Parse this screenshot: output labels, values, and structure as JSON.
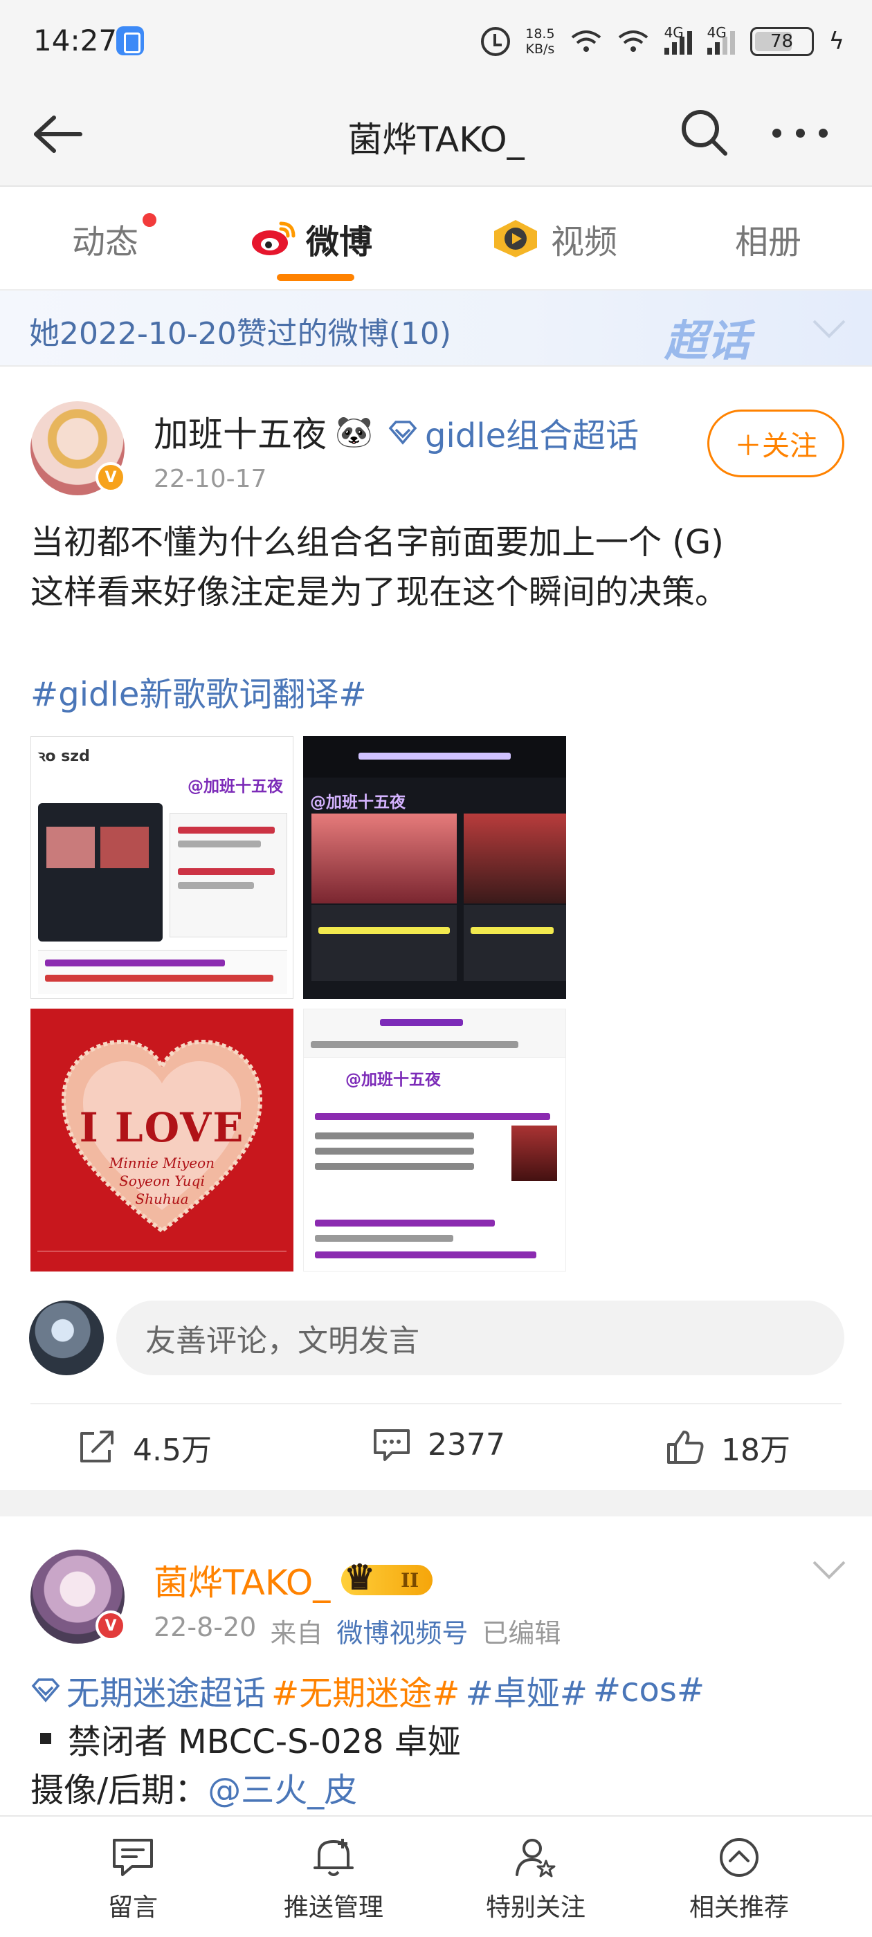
{
  "status_bar": {
    "time": "14:27",
    "speed_value": "18.5",
    "speed_unit": "KB/s",
    "network_1": "4G",
    "network_2": "4G",
    "battery": "78"
  },
  "header": {
    "title": "菌烨TAKO_"
  },
  "tabs": [
    {
      "label": "动态"
    },
    {
      "label": "微博"
    },
    {
      "label": "视频"
    },
    {
      "label": "相册"
    }
  ],
  "liked_banner": {
    "text": "她2022-10-20赞过的微博(10)",
    "mark": "超话"
  },
  "post1": {
    "author": "加班十五夜",
    "author_emoji": "🐼",
    "group_tag": "gidle组合超话",
    "date": "22-10-17",
    "follow_label": "＋关注",
    "text_line1": "当初都不懂为什么组合名字前面要加上一个 (G)",
    "text_line2": "这样看来好像注定是为了现在这个瞬间的决策。",
    "hashtag": "#gidle新歌歌词翻译#",
    "images": {
      "img1_brand": "ꝛo szd",
      "img1_watermark": "@加班十五夜",
      "img2_watermark": "@加班十五夜",
      "img3_title": "I LOVE",
      "img3_names": "Minnie Miyeon Soyeon Yuqi Shuhua",
      "img4_watermark": "@加班十五夜"
    },
    "comment_placeholder": "友善评论，文明发言",
    "actions": {
      "repost": "4.5万",
      "comment": "2377",
      "like": "18万"
    }
  },
  "post2": {
    "author": "菌烨TAKO_",
    "level": "II",
    "date": "22-8-20",
    "from_label": "来自",
    "source": "微博视频号",
    "edited": "已编辑",
    "tag_super": "无期迷途超话",
    "tag_game": "#无期迷途#",
    "tag_char": "#卓娅#",
    "tag_cos": "#cos#",
    "line2": "禁闭者 MBCC-S-028 卓娅",
    "line3_prefix": "摄像/后期：",
    "line3_mention": "@三火_皮"
  },
  "bottom_nav": [
    {
      "label": "留言",
      "icon": "message-icon"
    },
    {
      "label": "推送管理",
      "icon": "bell-plus-icon"
    },
    {
      "label": "特别关注",
      "icon": "user-star-icon"
    },
    {
      "label": "相关推荐",
      "icon": "chevron-up-circle-icon"
    }
  ],
  "colors": {
    "accent": "#ff8200",
    "link": "#4a76b8",
    "tab_underline": "#ff8200"
  }
}
